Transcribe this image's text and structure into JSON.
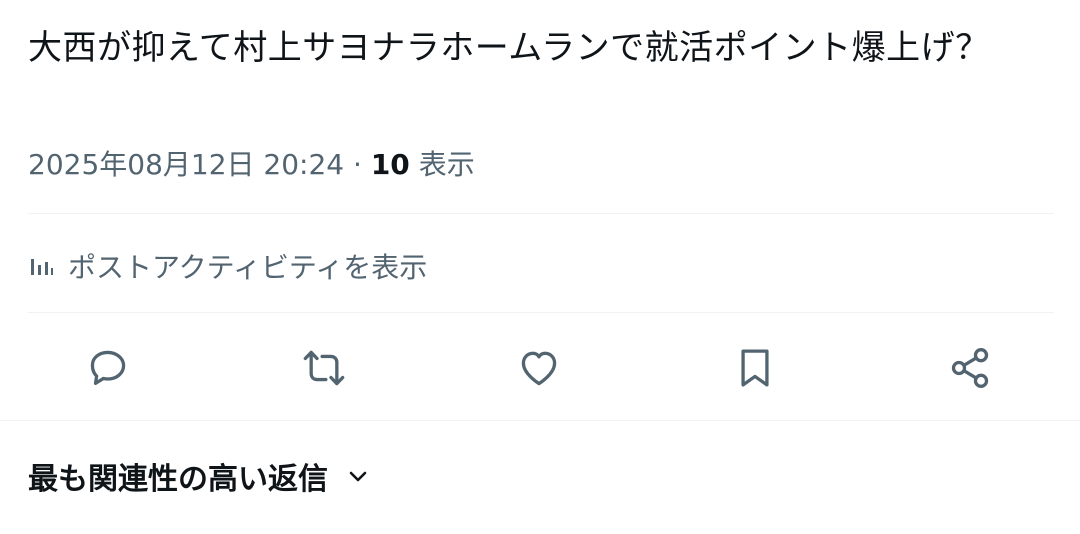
{
  "tweet": {
    "text": "大西が抑えて村上サヨナラホームランで就活ポイント爆上げ？",
    "timestamp": "2025年08月12日 20:24",
    "separator": "·",
    "views_count": "10",
    "views_label": "表示"
  },
  "activity": {
    "icon": "bar-chart-icon",
    "label": "ポストアクティビティを表示"
  },
  "actions": [
    {
      "name": "reply",
      "icon": "reply-icon"
    },
    {
      "name": "repost",
      "icon": "repost-icon"
    },
    {
      "name": "like",
      "icon": "heart-icon"
    },
    {
      "name": "bookmark",
      "icon": "bookmark-icon"
    },
    {
      "name": "share",
      "icon": "share-icon"
    }
  ],
  "replies": {
    "sort_label": "最も関連性の高い返信",
    "icon": "chevron-down-icon"
  },
  "colors": {
    "text_primary": "#0f1419",
    "text_secondary": "#536471",
    "divider": "#eff3f4"
  }
}
